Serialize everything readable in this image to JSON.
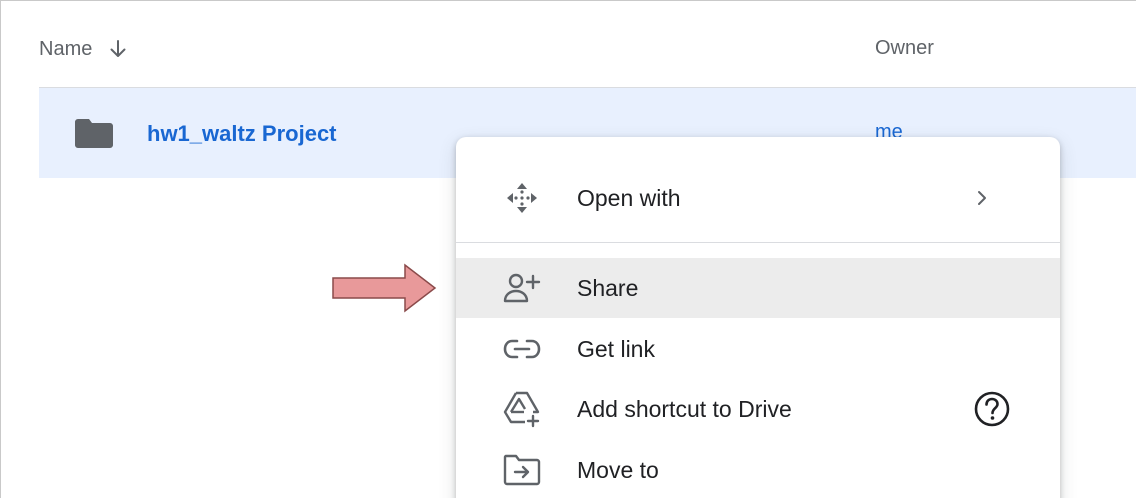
{
  "header": {
    "name_label": "Name",
    "owner_label": "Owner",
    "sort_icon": "arrow-down-icon"
  },
  "file": {
    "name": "hw1_waltz Project",
    "owner": "me",
    "icon": "folder-icon"
  },
  "menu": {
    "items": [
      {
        "label": "Open with",
        "icon": "open-with-icon",
        "has_submenu": true
      },
      {
        "label": "Share",
        "icon": "add-person-icon",
        "hovered": true
      },
      {
        "label": "Get link",
        "icon": "link-icon"
      },
      {
        "label": "Add shortcut to Drive",
        "icon": "add-shortcut-icon",
        "help": true
      },
      {
        "label": "Move to",
        "icon": "move-to-folder-icon"
      }
    ]
  },
  "colors": {
    "selection_bg": "#e8f0fe",
    "link_blue": "#1967d2",
    "arrow_fill": "#e8999a",
    "icon_gray": "#5f6368"
  }
}
